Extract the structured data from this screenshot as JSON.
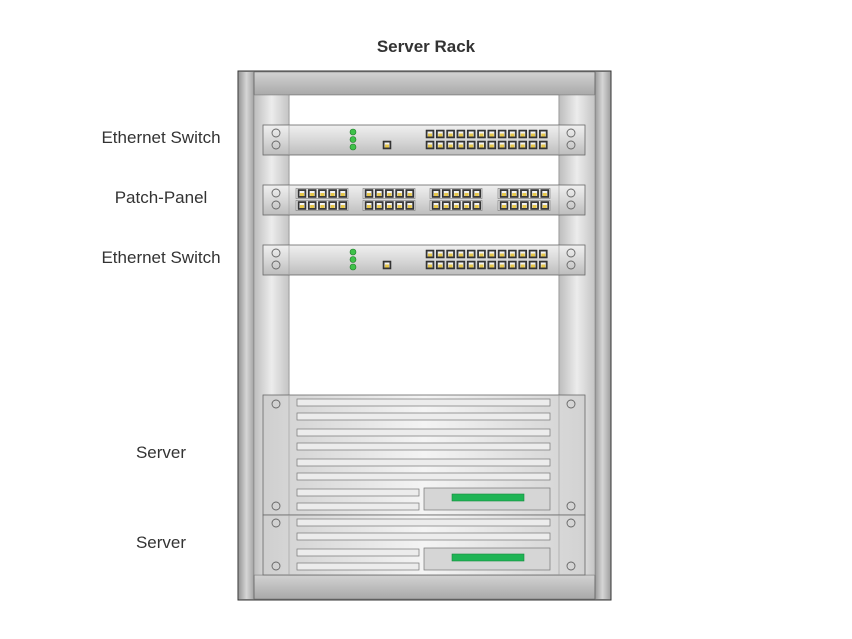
{
  "title": "Server Rack",
  "devices": [
    {
      "label": "Ethernet Switch",
      "type": "ethernet-switch"
    },
    {
      "label": "Patch-Panel",
      "type": "patch-panel"
    },
    {
      "label": "Ethernet Switch",
      "type": "ethernet-switch"
    },
    {
      "label": "Server",
      "type": "server-large"
    },
    {
      "label": "Server",
      "type": "server-small"
    }
  ],
  "colors": {
    "led": "#3ec24a",
    "drive_indicator": "#1fb455",
    "port_pin": "#e8c84a",
    "frame": "#b5b5b5",
    "device_face": "#dcdcdc"
  }
}
